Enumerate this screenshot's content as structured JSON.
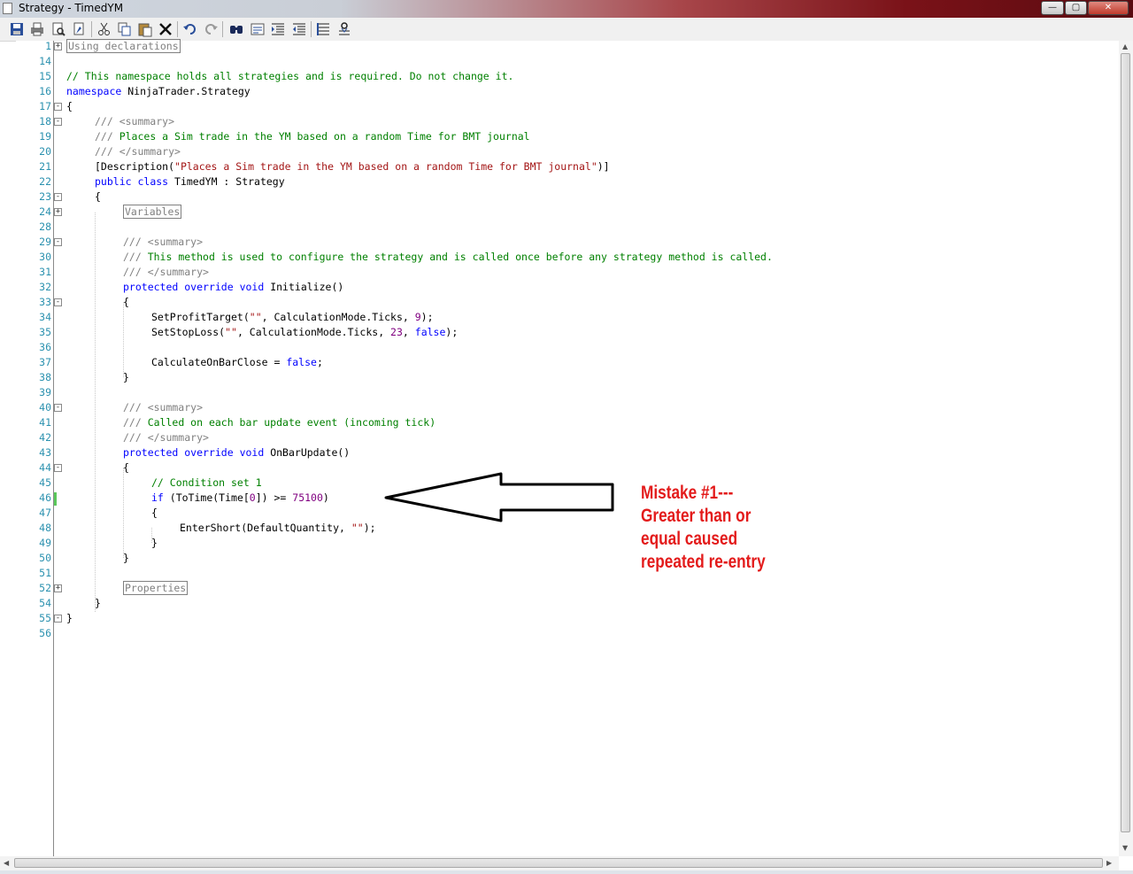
{
  "window": {
    "title": "Strategy - TimedYM",
    "minimize_glyph": "—",
    "maximize_glyph": "▢",
    "close_glyph": "✕"
  },
  "toolbar": {
    "icons": [
      "save-icon",
      "print-icon",
      "print-preview-icon",
      "properties-icon",
      "cut-icon",
      "copy-icon",
      "paste-icon",
      "delete-icon",
      "undo-icon",
      "redo-icon",
      "find-icon",
      "replace-icon",
      "indent-icon",
      "outdent-icon",
      "comment-icon",
      "uncomment-icon"
    ]
  },
  "editor": {
    "lines": [
      {
        "n": "1",
        "fold": "+"
      },
      {
        "n": "14"
      },
      {
        "n": "15"
      },
      {
        "n": "16"
      },
      {
        "n": "17",
        "fold": "-"
      },
      {
        "n": "18",
        "fold": "-"
      },
      {
        "n": "19"
      },
      {
        "n": "20"
      },
      {
        "n": "21"
      },
      {
        "n": "22"
      },
      {
        "n": "23",
        "fold": "-"
      },
      {
        "n": "24",
        "fold": "+"
      },
      {
        "n": "28"
      },
      {
        "n": "29",
        "fold": "-"
      },
      {
        "n": "30"
      },
      {
        "n": "31"
      },
      {
        "n": "32"
      },
      {
        "n": "33",
        "fold": "-"
      },
      {
        "n": "34"
      },
      {
        "n": "35"
      },
      {
        "n": "36"
      },
      {
        "n": "37"
      },
      {
        "n": "38"
      },
      {
        "n": "39"
      },
      {
        "n": "40",
        "fold": "-"
      },
      {
        "n": "41"
      },
      {
        "n": "42"
      },
      {
        "n": "43"
      },
      {
        "n": "44",
        "fold": "-"
      },
      {
        "n": "45"
      },
      {
        "n": "46"
      },
      {
        "n": "47"
      },
      {
        "n": "48"
      },
      {
        "n": "49"
      },
      {
        "n": "50"
      },
      {
        "n": "51"
      },
      {
        "n": "52",
        "fold": "+"
      },
      {
        "n": "54"
      },
      {
        "n": "55",
        "fold": "-"
      },
      {
        "n": "56"
      }
    ],
    "code": {
      "l1_region": "Using declarations",
      "l15": "// This namespace holds all strategies and is required. Do not change it.",
      "l16_kw": "namespace",
      "l16_rest": " NinjaTrader.Strategy",
      "l17": "{",
      "l18_gray": "/// <summary>",
      "l19_a": "/// ",
      "l19_b": "Places a Sim trade in the YM based on a random Time for BMT journal",
      "l20": "/// </summary>",
      "l21_a": "[Description(",
      "l21_b": "\"Places a Sim trade in the YM based on a random Time for BMT journal\"",
      "l21_c": ")]",
      "l22_kw1": "public",
      "l22_kw2": "class",
      "l22_rest": " TimedYM : Strategy",
      "l23": "{",
      "l24_region": "Variables",
      "l29": "/// <summary>",
      "l30_a": "/// ",
      "l30_b": "This method is used to configure the strategy and is called once before any strategy method is called.",
      "l31": "/// </summary>",
      "l32_kw1": "protected",
      "l32_kw2": "override",
      "l32_kw3": "void",
      "l32_rest": " Initialize()",
      "l33": "{",
      "l34_a": "SetProfitTarget(",
      "l34_b": "\"\"",
      "l34_c": ", CalculationMode.Ticks, ",
      "l34_d": "9",
      "l34_e": ");",
      "l35_a": "SetStopLoss(",
      "l35_b": "\"\"",
      "l35_c": ", CalculationMode.Ticks, ",
      "l35_d": "23",
      "l35_e": ", ",
      "l35_f": "false",
      "l35_g": ");",
      "l37_a": "CalculateOnBarClose = ",
      "l37_b": "false",
      "l37_c": ";",
      "l38": "}",
      "l40": "/// <summary>",
      "l41_a": "/// ",
      "l41_b": "Called on each bar update event (incoming tick)",
      "l42": "/// </summary>",
      "l43_kw1": "protected",
      "l43_kw2": "override",
      "l43_kw3": "void",
      "l43_rest": " OnBarUpdate()",
      "l44": "{",
      "l45": "// Condition set 1",
      "l46_kw": "if",
      "l46_a": " (ToTime(Time[",
      "l46_b": "0",
      "l46_c": "]) >= ",
      "l46_d": "75100",
      "l46_e": ")",
      "l47": "{",
      "l48_a": "EnterShort(DefaultQuantity, ",
      "l48_b": "\"\"",
      "l48_c": ");",
      "l49": "}",
      "l50": "}",
      "l52_region": "Properties",
      "l54": "}",
      "l55": "}"
    }
  },
  "annotation": {
    "lines": [
      "Mistake #1---",
      "Greater than or",
      "equal caused",
      "repeated re-entry"
    ],
    "color": "#e31b1b"
  }
}
